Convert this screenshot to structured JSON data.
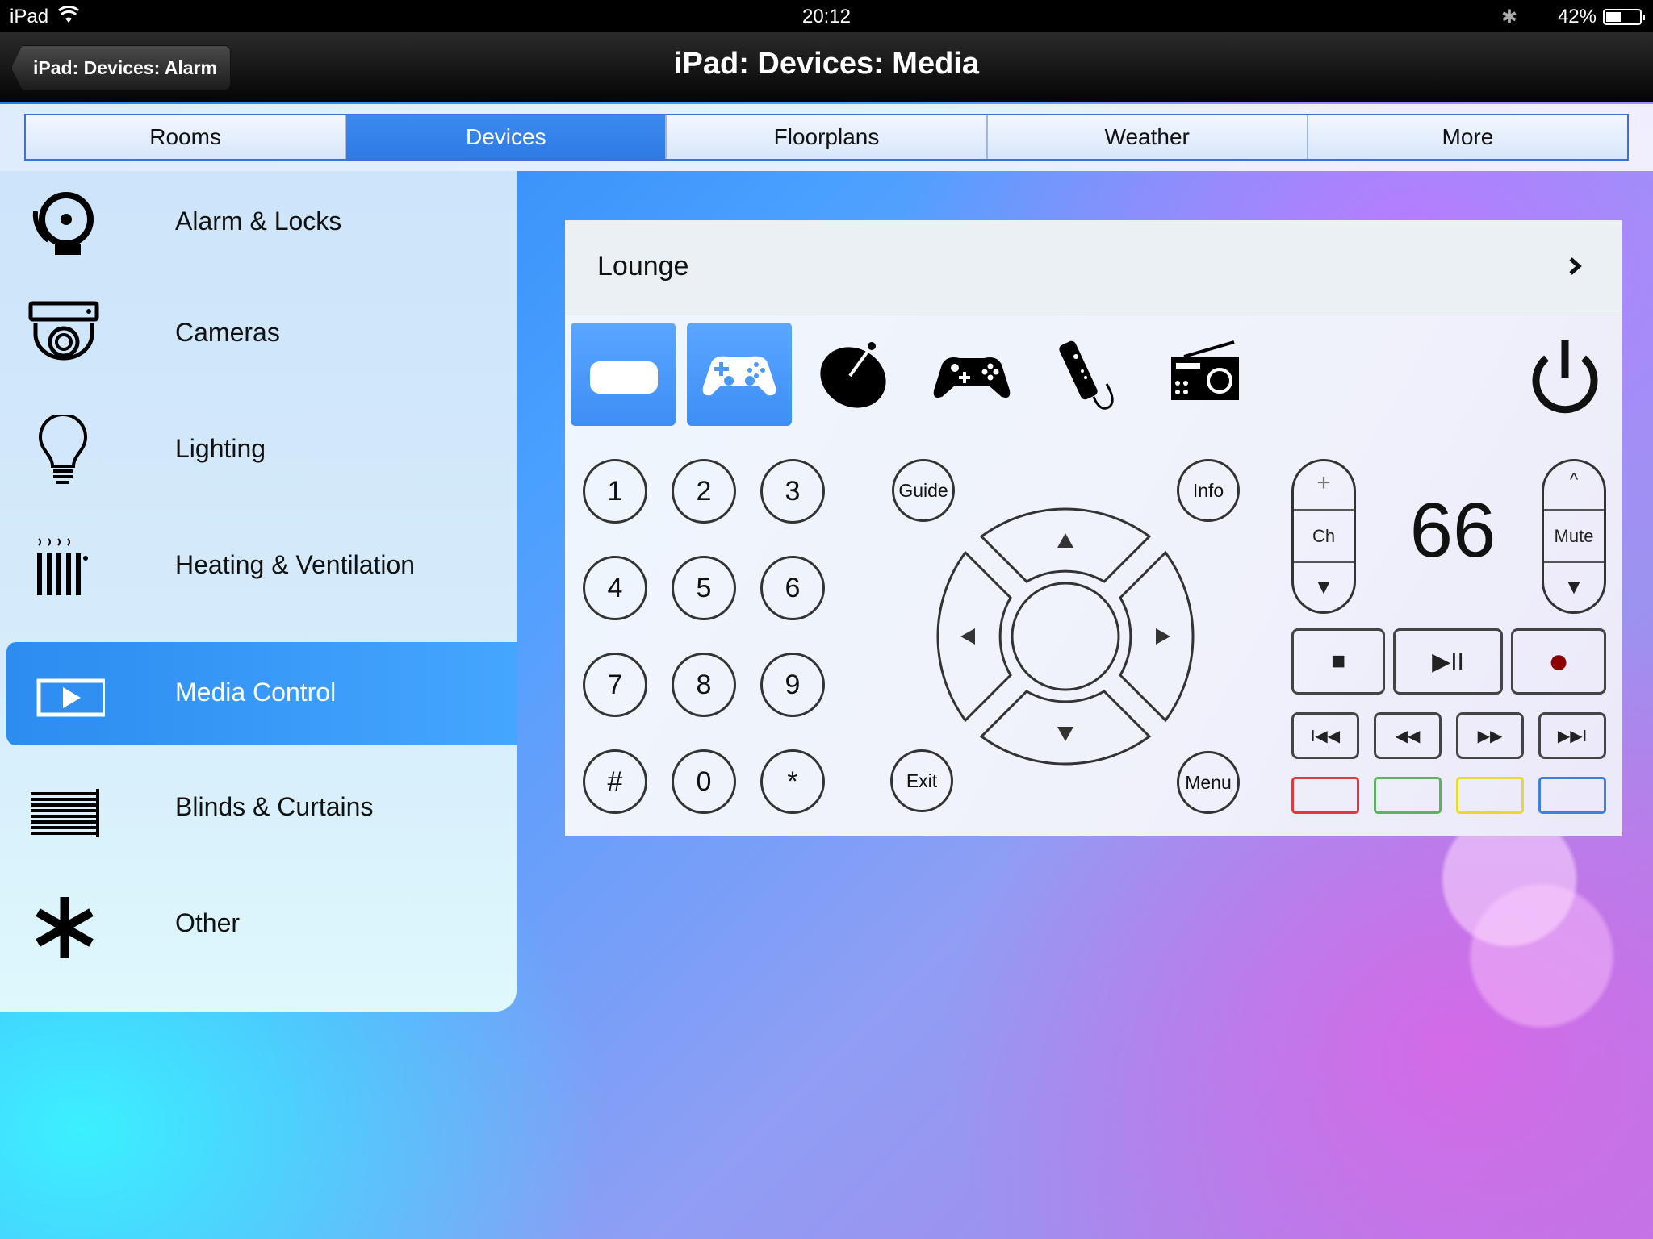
{
  "status_bar": {
    "carrier": "iPad",
    "time": "20:12",
    "battery": "42%"
  },
  "nav": {
    "back_label": "iPad: Devices: Alarm",
    "title": "iPad: Devices: Media"
  },
  "tabs": [
    {
      "label": "Rooms"
    },
    {
      "label": "Devices"
    },
    {
      "label": "Floorplans"
    },
    {
      "label": "Weather"
    },
    {
      "label": "More"
    }
  ],
  "active_tab": "Devices",
  "sidebar": {
    "items": [
      {
        "label": "Alarm & Locks",
        "icon": "alarm-bell-icon"
      },
      {
        "label": "Cameras",
        "icon": "security-camera-icon"
      },
      {
        "label": "Lighting",
        "icon": "light-bulb-icon"
      },
      {
        "label": "Heating & Ventilation",
        "icon": "radiator-icon"
      },
      {
        "label": "Media Control",
        "icon": "play-screen-icon"
      },
      {
        "label": "Blinds & Curtains",
        "icon": "blinds-icon"
      },
      {
        "label": "Other",
        "icon": "asterisk-icon"
      }
    ],
    "active": "Media Control"
  },
  "panel": {
    "room": "Lounge",
    "devices": [
      {
        "icon": "set-top-box-icon",
        "selected": true
      },
      {
        "icon": "gamepad-icon",
        "selected": true
      },
      {
        "icon": "satellite-dish-icon",
        "selected": false
      },
      {
        "icon": "xbox-controller-icon",
        "selected": false
      },
      {
        "icon": "wii-remote-icon",
        "selected": false
      },
      {
        "icon": "radio-icon",
        "selected": false
      }
    ],
    "keypad": [
      "1",
      "2",
      "3",
      "4",
      "5",
      "6",
      "7",
      "8",
      "9",
      "#",
      "0",
      "*"
    ],
    "guide": "Guide",
    "info": "Info",
    "exit": "Exit",
    "menu": "Menu",
    "channel_rocker": {
      "up": "+",
      "label": "Ch",
      "down": "▼"
    },
    "volume_rocker": {
      "up": "^",
      "label": "Mute",
      "down": "▼"
    },
    "channel_number": "66",
    "transport": {
      "stop": "■",
      "play_pause": "▶II",
      "record": "●"
    },
    "skip": {
      "prev": "I◀◀",
      "rewind": "◀◀",
      "forward": "▶▶",
      "next": "▶▶I"
    },
    "color_buttons": [
      "#e23a3a",
      "#5db35d",
      "#e6d92f",
      "#3b82e0"
    ],
    "power_icon": "power-icon"
  },
  "colors": {
    "accent": "#2f7ae6",
    "selected_device": "#4a9bf9"
  }
}
